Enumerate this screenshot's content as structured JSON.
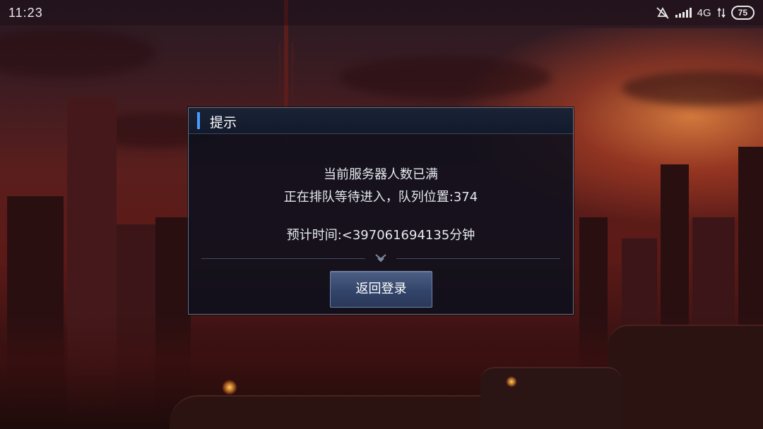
{
  "status_bar": {
    "time": "11:23",
    "network": "4G",
    "battery": "75"
  },
  "dialog": {
    "title": "提示",
    "line1": "当前服务器人数已满",
    "line2": "正在排队等待进入，队列位置:374",
    "line3": "预计时间:<397061694135分钟",
    "button_label": "返回登录"
  },
  "colors": {
    "accent": "#4a9bff",
    "dialog_bg": "#0c101c",
    "button": "#3a4b70"
  }
}
